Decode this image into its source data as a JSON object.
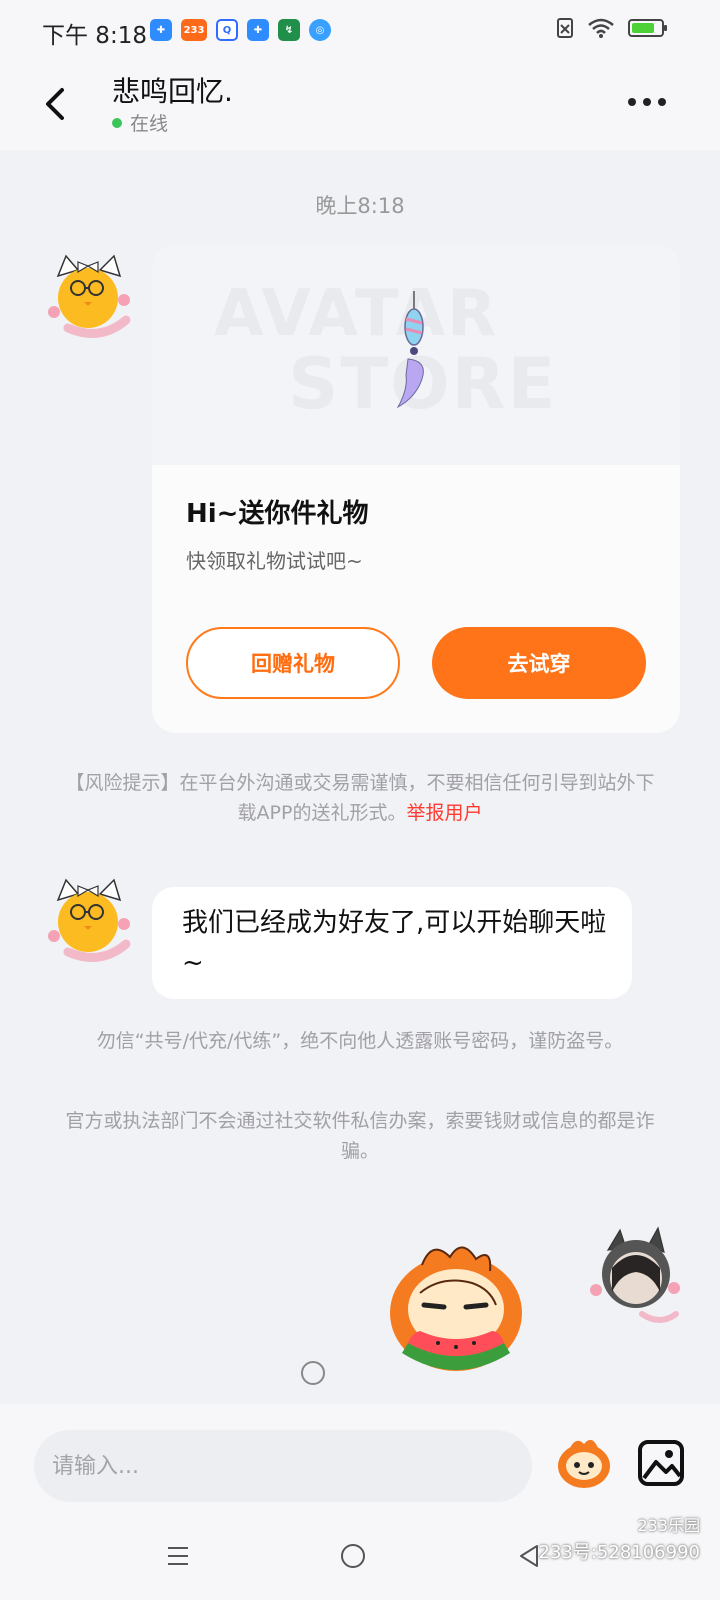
{
  "status_bar": {
    "time": "下午 8:18",
    "app_icons": [
      "puzzle-icon",
      "233-app-icon",
      "search-app-icon",
      "puzzle-icon",
      "phone-green-icon",
      "search-app-icon"
    ],
    "app_icon_badge": "233",
    "icons_right": [
      "no-sim-icon",
      "wifi-icon",
      "battery-charging-icon"
    ]
  },
  "header": {
    "contact_name": "悲鸣回忆.",
    "online_status": "在线",
    "online_color": "#3cc55a"
  },
  "chat": {
    "timestamp": "晚上8:18",
    "gift_card": {
      "banner_watermark_1": "AVATAR",
      "banner_watermark_2": "STORE",
      "title": "Hi~送你件礼物",
      "subtitle": "快领取礼物试试吧~",
      "return_gift_label": "回赠礼物",
      "try_on_label": "去试穿"
    },
    "risk_notice": "【风险提示】在平台外沟通或交易需谨慎，不要相信任何引导到站外下载APP的送礼形式。",
    "report_user_label": "举报用户",
    "friend_message": "我们已经成为好友了,可以开始聊天啦~",
    "warning_1": "勿信“共号/代充/代练”，绝不向他人透露账号密码，谨防盗号。",
    "warning_2": "官方或执法部门不会通过社交软件私信办案，索要钱财或信息的都是诈骗。"
  },
  "input_bar": {
    "placeholder": "请输入...",
    "emoji_icon": "mascot-emoji-icon",
    "image_icon": "image-picker-icon"
  },
  "nav": {
    "watermark_brand": "233乐园",
    "watermark_id": "233号:528106990"
  },
  "colors": {
    "accent": "#ff7418",
    "report": "#ff3b30",
    "background": "#f1f2f6"
  }
}
